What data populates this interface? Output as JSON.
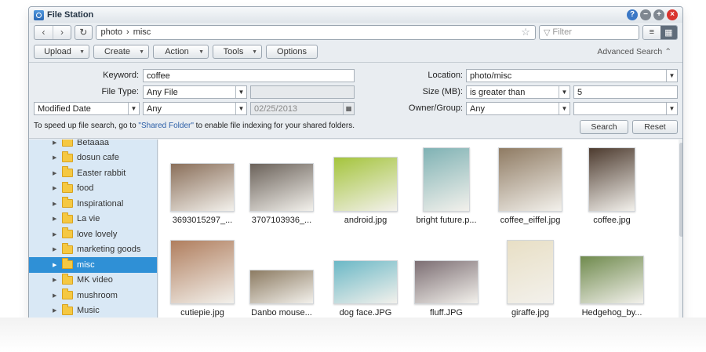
{
  "window": {
    "title": "File Station",
    "controls": {
      "help": "?",
      "min": "−",
      "max": "+",
      "close": "×"
    }
  },
  "nav": {
    "back": "‹",
    "forward": "›",
    "refresh": "↻",
    "path_root": "photo",
    "path_sep": "›",
    "path_leaf": "misc",
    "filter_placeholder": "Filter",
    "view_list": "≡",
    "view_thumb": "▦"
  },
  "toolbar": {
    "upload": "Upload",
    "create": "Create",
    "action": "Action",
    "tools": "Tools",
    "options": "Options",
    "advanced": "Advanced Search"
  },
  "search": {
    "keyword_label": "Keyword:",
    "keyword_value": "coffee",
    "filetype_label": "File Type:",
    "filetype_value": "Any File",
    "date_type_value": "Modified Date",
    "date_range_value": "Any",
    "date_value": "02/25/2013",
    "location_label": "Location:",
    "location_value": "photo/misc",
    "size_label": "Size (MB):",
    "size_op_value": "is greater than",
    "size_value": "5",
    "owner_label": "Owner/Group:",
    "owner_value": "Any",
    "hint_pre": "To speed up file search, go to ",
    "hint_link": "\"Shared Folder\"",
    "hint_post": " to enable file indexing for your shared folders.",
    "search_button": "Search",
    "reset_button": "Reset"
  },
  "tree": {
    "items": [
      {
        "label": "Betaaaa",
        "selected": false
      },
      {
        "label": "dosun cafe",
        "selected": false
      },
      {
        "label": "Easter rabbit",
        "selected": false
      },
      {
        "label": "food",
        "selected": false
      },
      {
        "label": "Inspirational",
        "selected": false
      },
      {
        "label": "La vie",
        "selected": false
      },
      {
        "label": "love lovely",
        "selected": false
      },
      {
        "label": "marketing goods",
        "selected": false
      },
      {
        "label": "misc",
        "selected": true
      },
      {
        "label": "MK video",
        "selected": false
      },
      {
        "label": "mushroom",
        "selected": false
      },
      {
        "label": "Music",
        "selected": false
      }
    ]
  },
  "files": [
    {
      "name": "3693015297_...",
      "color": "#8a6f5a"
    },
    {
      "name": "3707103936_...",
      "color": "#6b625a"
    },
    {
      "name": "android.jpg",
      "color": "#a4c43c"
    },
    {
      "name": "bright future.p...",
      "color": "#7fb2b4"
    },
    {
      "name": "coffee_eiffel.jpg",
      "color": "#8f7b63"
    },
    {
      "name": "coffee.jpg",
      "color": "#4d3b2f"
    },
    {
      "name": "cutiepie.jpg",
      "color": "#b07e5e"
    },
    {
      "name": "Danbo mouse...",
      "color": "#8c7b62"
    },
    {
      "name": "dog face.JPG",
      "color": "#6bb8c6"
    },
    {
      "name": "fluff.JPG",
      "color": "#7c6e73"
    },
    {
      "name": "giraffe.jpg",
      "color": "#e8dfc5"
    },
    {
      "name": "Hedgehog_by...",
      "color": "#6f8a4d"
    }
  ]
}
